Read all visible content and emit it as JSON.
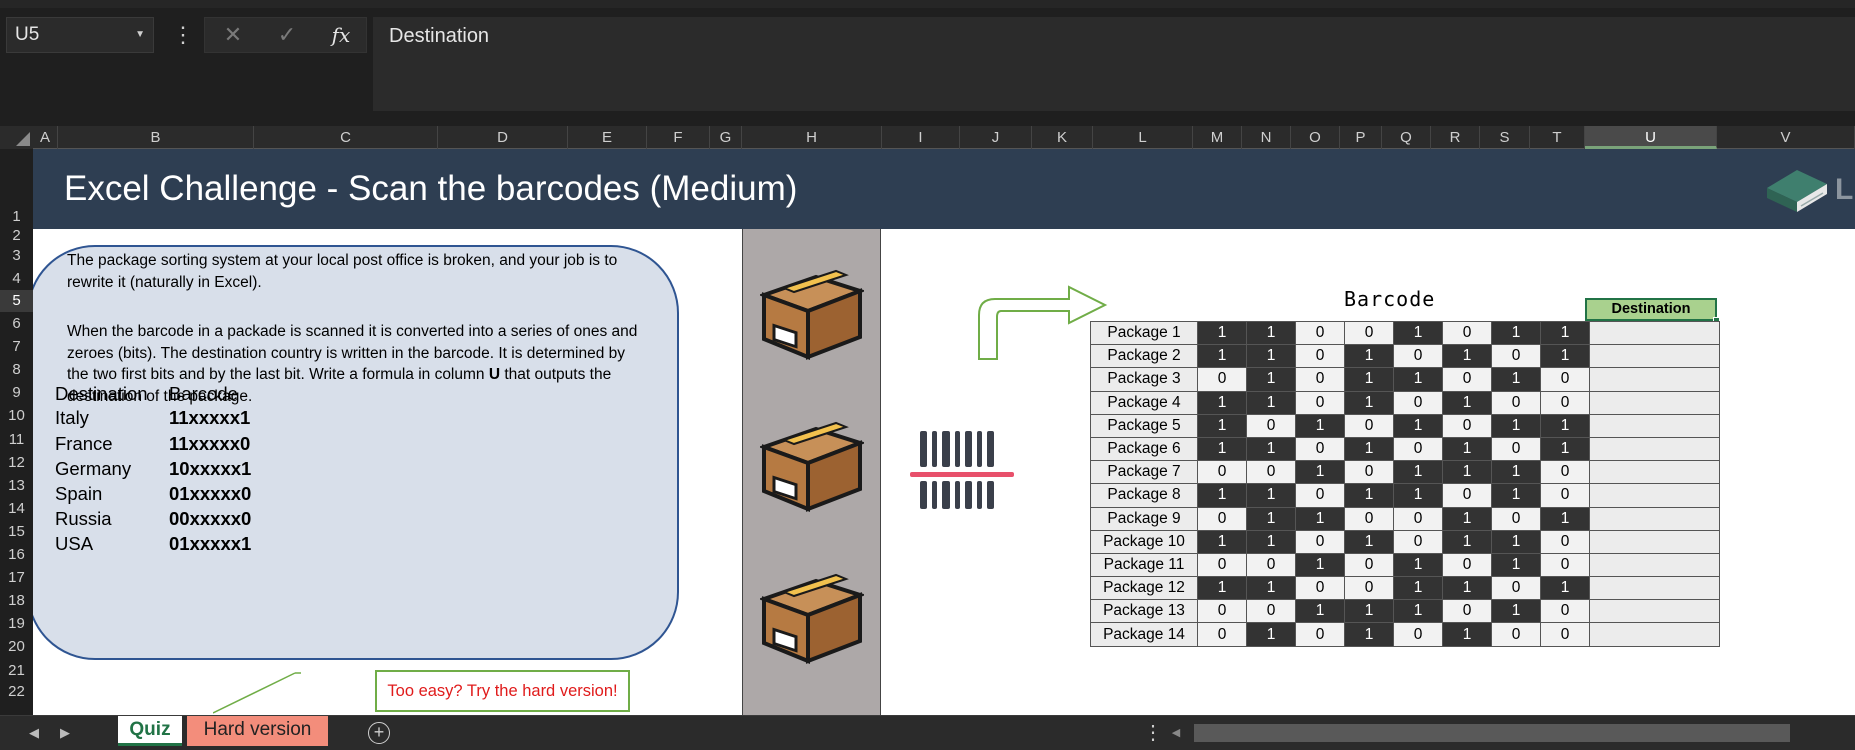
{
  "formula_bar": {
    "name_box": "U5",
    "more_icon": "⋮",
    "cancel_icon": "✕",
    "enter_icon": "✓",
    "fx_icon": "fx",
    "formula": "Destination"
  },
  "columns": [
    "A",
    "B",
    "C",
    "D",
    "E",
    "F",
    "G",
    "H",
    "I",
    "J",
    "K",
    "L",
    "M",
    "N",
    "O",
    "P",
    "Q",
    "R",
    "S",
    "T",
    "U",
    "V"
  ],
  "selected_column": "U",
  "rows": [
    "1",
    "2",
    "3",
    "4",
    "5",
    "6",
    "7",
    "8",
    "9",
    "10",
    "11",
    "12",
    "13",
    "14",
    "15",
    "16",
    "17",
    "18",
    "19",
    "20",
    "21",
    "22"
  ],
  "selected_row": "5",
  "banner": {
    "title": "Excel Challenge - Scan the barcodes (Medium)",
    "logo_text": "LEARNESY"
  },
  "instructions": {
    "para1": "The package sorting system at your local post office is broken, and your job is to rewrite it (naturally in Excel).",
    "para2_a": "When the barcode in a packade is scanned it is converted into a series of ones and zeroes (bits).  The destination country is written in the barcode. It is determined by the two first bits and by the last bit. Write a formula in column ",
    "para2_b": "U",
    "para2_c": " that outputs the destination of the package."
  },
  "legend": {
    "header_destination": "Destination",
    "header_barcode": "Barcode",
    "rows": [
      {
        "country": "Italy",
        "code": "11xxxxx1"
      },
      {
        "country": "France",
        "code": "11xxxxx0"
      },
      {
        "country": "Germany",
        "code": "10xxxxx1"
      },
      {
        "country": "Spain",
        "code": "01xxxxx0"
      },
      {
        "country": "Russia",
        "code": "00xxxxx0"
      },
      {
        "country": "USA",
        "code": "01xxxxx1"
      }
    ]
  },
  "hard_link": "Too easy? Try the hard version!",
  "barcode_table": {
    "title": "Barcode",
    "destination_header": "Destination",
    "packages": [
      {
        "label": "Package 1",
        "bits": [
          1,
          1,
          0,
          0,
          1,
          0,
          1,
          1
        ]
      },
      {
        "label": "Package 2",
        "bits": [
          1,
          1,
          0,
          1,
          0,
          1,
          0,
          1
        ]
      },
      {
        "label": "Package 3",
        "bits": [
          0,
          1,
          0,
          1,
          1,
          0,
          1,
          0
        ]
      },
      {
        "label": "Package 4",
        "bits": [
          1,
          1,
          0,
          1,
          0,
          1,
          0,
          0
        ]
      },
      {
        "label": "Package 5",
        "bits": [
          1,
          0,
          1,
          0,
          1,
          0,
          1,
          1
        ]
      },
      {
        "label": "Package 6",
        "bits": [
          1,
          1,
          0,
          1,
          0,
          1,
          0,
          1
        ]
      },
      {
        "label": "Package 7",
        "bits": [
          0,
          0,
          1,
          0,
          1,
          1,
          1,
          0
        ]
      },
      {
        "label": "Package 8",
        "bits": [
          1,
          1,
          0,
          1,
          1,
          0,
          1,
          0
        ]
      },
      {
        "label": "Package 9",
        "bits": [
          0,
          1,
          1,
          0,
          0,
          1,
          0,
          1
        ]
      },
      {
        "label": "Package 10",
        "bits": [
          1,
          1,
          0,
          1,
          0,
          1,
          1,
          0
        ]
      },
      {
        "label": "Package 11",
        "bits": [
          0,
          0,
          1,
          0,
          1,
          0,
          1,
          0
        ]
      },
      {
        "label": "Package 12",
        "bits": [
          1,
          1,
          0,
          0,
          1,
          1,
          0,
          1
        ]
      },
      {
        "label": "Package 13",
        "bits": [
          0,
          0,
          1,
          1,
          1,
          0,
          1,
          0
        ]
      },
      {
        "label": "Package 14",
        "bits": [
          0,
          1,
          0,
          1,
          0,
          1,
          0,
          0
        ]
      }
    ]
  },
  "tabs": {
    "prev_icon": "◀",
    "next_icon": "▶",
    "quiz": "Quiz",
    "hard": "Hard version",
    "add_icon": "+",
    "more_icon": "⋮",
    "scroll_left_icon": "◀"
  },
  "colors": {
    "banner": "#2e3e52",
    "infobox_fill": "#d8dfea",
    "infobox_border": "#2f5592",
    "bit_one": "#333333",
    "bit_zero": "#f2f2f2",
    "destination_header": "#a9d18e",
    "hard_tab": "#f38d7b",
    "hard_link_text": "#e01b1b",
    "accent_green": "#70ad47"
  }
}
